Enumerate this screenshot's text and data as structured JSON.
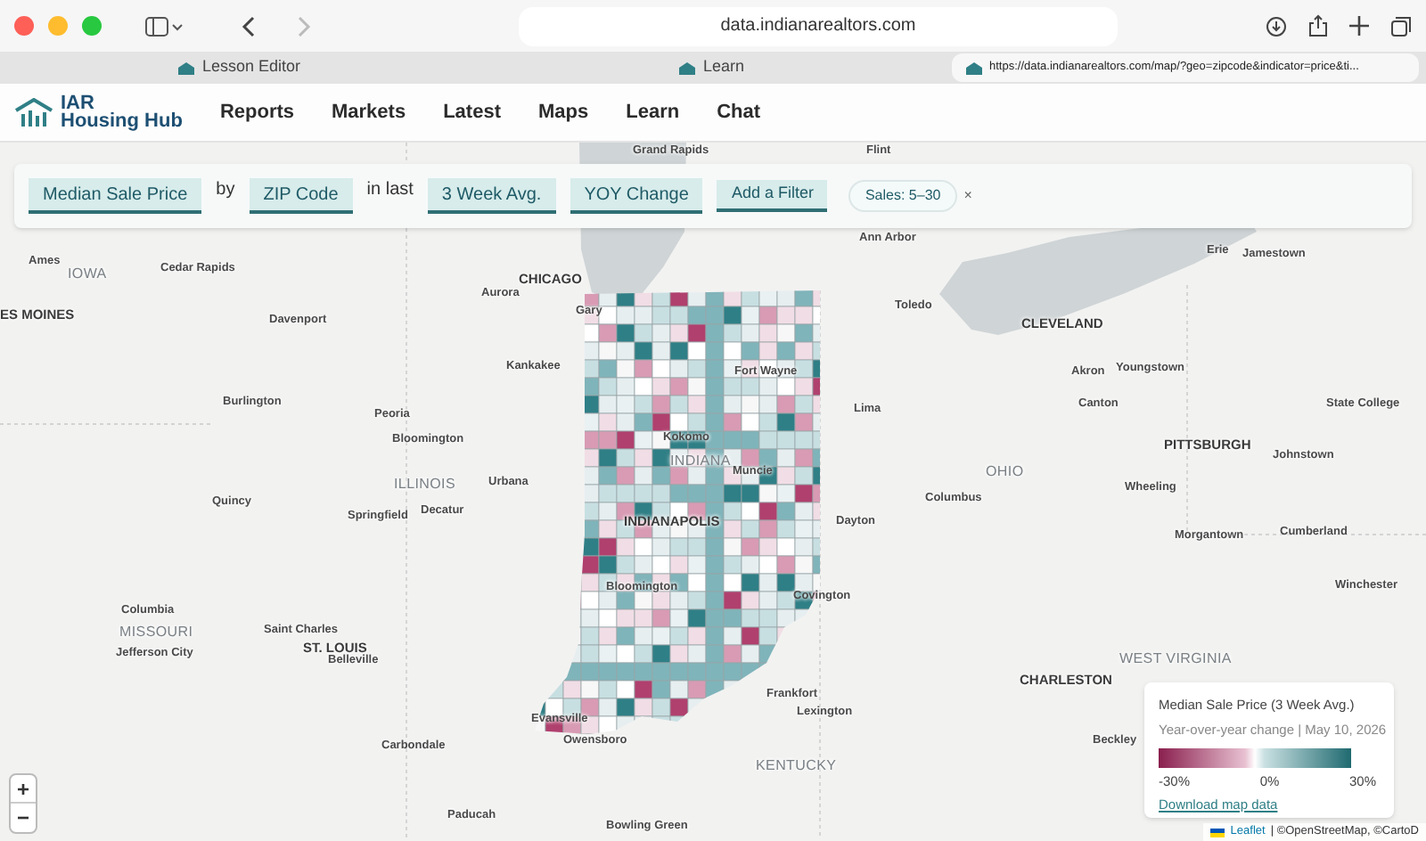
{
  "browser": {
    "url": "data.indianarealtors.com",
    "tabs": [
      {
        "label": "Lesson Editor",
        "selected": false
      },
      {
        "label": "Learn",
        "selected": false
      },
      {
        "label": "https://data.indianarealtors.com/map/?geo=zipcode&indicator=price&ti...",
        "selected": true
      }
    ]
  },
  "site": {
    "logo_line1": "IAR",
    "logo_line2": "Housing Hub",
    "nav": [
      "Reports",
      "Markets",
      "Latest",
      "Maps",
      "Learn",
      "Chat"
    ]
  },
  "filters": [
    {
      "kind": "select",
      "label": "Median Sale Price"
    },
    {
      "kind": "text",
      "label": "by"
    },
    {
      "kind": "select",
      "label": "ZIP Code"
    },
    {
      "kind": "text",
      "label": "in last"
    },
    {
      "kind": "select",
      "label": "3 Week Avg."
    },
    {
      "kind": "select",
      "label": "YOY Change"
    },
    {
      "kind": "button",
      "label": "Add a Filter"
    },
    {
      "kind": "chip",
      "label": "Sales: 5–30",
      "close": "×"
    }
  ],
  "map_labels": [
    {
      "text": "Grand Rapids",
      "kind": "city"
    },
    {
      "text": "Flint",
      "kind": "city"
    },
    {
      "text": "Ames",
      "kind": "city"
    },
    {
      "text": "IOWA",
      "kind": "state"
    },
    {
      "text": "ES MOINES",
      "kind": "metro"
    },
    {
      "text": "Cedar Rapids",
      "kind": "city"
    },
    {
      "text": "Davenport",
      "kind": "city"
    },
    {
      "text": "CHICAGO",
      "kind": "metro"
    },
    {
      "text": "Aurora",
      "kind": "city"
    },
    {
      "text": "Gary",
      "kind": "city"
    },
    {
      "text": "Kankakee",
      "kind": "city"
    },
    {
      "text": "Burlington",
      "kind": "city"
    },
    {
      "text": "Peoria",
      "kind": "city"
    },
    {
      "text": "Bloomington",
      "kind": "city"
    },
    {
      "text": "ILLINOIS",
      "kind": "state"
    },
    {
      "text": "Urbana",
      "kind": "city"
    },
    {
      "text": "Quincy",
      "kind": "city"
    },
    {
      "text": "Springfield",
      "kind": "city"
    },
    {
      "text": "Decatur",
      "kind": "city"
    },
    {
      "text": "Columbia",
      "kind": "city"
    },
    {
      "text": "MISSOURI",
      "kind": "state"
    },
    {
      "text": "Saint Charles",
      "kind": "city"
    },
    {
      "text": "ST. LOUIS",
      "kind": "metro"
    },
    {
      "text": "Belleville",
      "kind": "city"
    },
    {
      "text": "Jefferson City",
      "kind": "city"
    },
    {
      "text": "Carbondale",
      "kind": "city"
    },
    {
      "text": "Paducah",
      "kind": "city"
    },
    {
      "text": "Bowling Green",
      "kind": "city"
    },
    {
      "text": "Owensboro",
      "kind": "city"
    },
    {
      "text": "Evansville",
      "kind": "city"
    },
    {
      "text": "INDIANAPOLIS",
      "kind": "metro"
    },
    {
      "text": "Bloomington",
      "kind": "city"
    },
    {
      "text": "Kokomo",
      "kind": "city"
    },
    {
      "text": "INDIANA",
      "kind": "state"
    },
    {
      "text": "Ann Arbor",
      "kind": "city"
    },
    {
      "text": "Toledo",
      "kind": "city"
    },
    {
      "text": "CLEVELAND",
      "kind": "metro"
    },
    {
      "text": "Erie",
      "kind": "city"
    },
    {
      "text": "Jamestown",
      "kind": "city"
    },
    {
      "text": "Fort Wayne",
      "kind": "city"
    },
    {
      "text": "Akron",
      "kind": "city"
    },
    {
      "text": "Youngstown",
      "kind": "city"
    },
    {
      "text": "Lima",
      "kind": "city"
    },
    {
      "text": "Canton",
      "kind": "city"
    },
    {
      "text": "State College",
      "kind": "city"
    },
    {
      "text": "PITTSBURGH",
      "kind": "metro"
    },
    {
      "text": "Johnstown",
      "kind": "city"
    },
    {
      "text": "OHIO",
      "kind": "state"
    },
    {
      "text": "Columbus",
      "kind": "city"
    },
    {
      "text": "Wheeling",
      "kind": "city"
    },
    {
      "text": "Dayton",
      "kind": "city"
    },
    {
      "text": "Muncie",
      "kind": "city"
    },
    {
      "text": "Morgantown",
      "kind": "city"
    },
    {
      "text": "Cumberland",
      "kind": "city"
    },
    {
      "text": "Covington",
      "kind": "city"
    },
    {
      "text": "Winchester",
      "kind": "city"
    },
    {
      "text": "WEST VIRGINIA",
      "kind": "state"
    },
    {
      "text": "CHARLESTON",
      "kind": "metro"
    },
    {
      "text": "Frankfort",
      "kind": "city"
    },
    {
      "text": "Lexington",
      "kind": "city"
    },
    {
      "text": "KENTUCKY",
      "kind": "state"
    },
    {
      "text": "Beckley",
      "kind": "city"
    }
  ],
  "zoom": {
    "in": "+",
    "out": "−"
  },
  "legend": {
    "title": "Median Sale Price (3 Week Avg.)",
    "subtitle": "Year-over-year change | May 10, 2026",
    "min": "-30%",
    "mid": "0%",
    "max": "30%",
    "link": "Download map data"
  },
  "attribution": {
    "link": "Leaflet",
    "text": "| ©OpenStreetMap, ©CartoD"
  }
}
